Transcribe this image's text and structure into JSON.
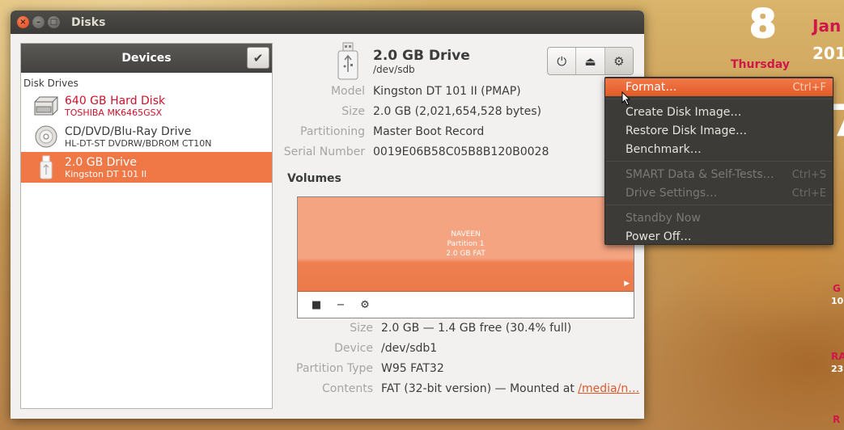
{
  "desktop": {
    "day": "8",
    "month": "Jan",
    "weekday": "Thursday",
    "year": "201",
    "big": "7",
    "w1": "G",
    "w1b": "10",
    "w2": "RA",
    "w2b": "23",
    "w3": "R"
  },
  "window": {
    "title": "Disks"
  },
  "sidebar": {
    "header": "Devices",
    "section": "Disk Drives",
    "devices": [
      {
        "title": "640 GB Hard Disk",
        "subtitle": "TOSHIBA MK6465GSX",
        "icon": "hard-disk-icon"
      },
      {
        "title": "CD/DVD/Blu-Ray Drive",
        "subtitle": "HL-DT-ST DVDRW/BDROM CT10N",
        "icon": "optical-disc-icon"
      },
      {
        "title": "2.0 GB Drive",
        "subtitle": "Kingston DT 101 II",
        "icon": "usb-drive-icon"
      }
    ]
  },
  "drive": {
    "title": "2.0 GB Drive",
    "path": "/dev/sdb",
    "properties": [
      {
        "label": "Model",
        "value": "Kingston DT 101 II (PMAP)"
      },
      {
        "label": "Size",
        "value": "2.0 GB (2,021,654,528 bytes)"
      },
      {
        "label": "Partitioning",
        "value": "Master Boot Record"
      },
      {
        "label": "Serial Number",
        "value": "0019E06B58C05B8B120B0028"
      }
    ]
  },
  "volumes": {
    "label": "Volumes",
    "partition": {
      "name": "NAVEEN",
      "number": "Partition 1",
      "desc": "2.0 GB FAT"
    },
    "details": [
      {
        "label": "Size",
        "value": "2.0 GB — 1.4 GB free (30.4% full)"
      },
      {
        "label": "Device",
        "value": "/dev/sdb1"
      },
      {
        "label": "Partition Type",
        "value": "W95 FAT32"
      },
      {
        "label": "Contents",
        "value": "FAT (32-bit version) — Mounted at ",
        "link": "/media/n…"
      }
    ]
  },
  "menu": {
    "items": [
      {
        "label": "Format…",
        "accel": "Ctrl+F"
      },
      {
        "label": "Create Disk Image…",
        "accel": ""
      },
      {
        "label": "Restore Disk Image…",
        "accel": ""
      },
      {
        "label": "Benchmark…",
        "accel": ""
      },
      {
        "label": "SMART Data & Self-Tests…",
        "accel": "Ctrl+S"
      },
      {
        "label": "Drive Settings…",
        "accel": "Ctrl+E"
      },
      {
        "label": "Standby Now",
        "accel": ""
      },
      {
        "label": "Power Off…",
        "accel": ""
      }
    ]
  },
  "colors": {
    "accent": "#f07746",
    "menu_bg": "#3c3b37",
    "titlebar": "#3c3b37"
  }
}
